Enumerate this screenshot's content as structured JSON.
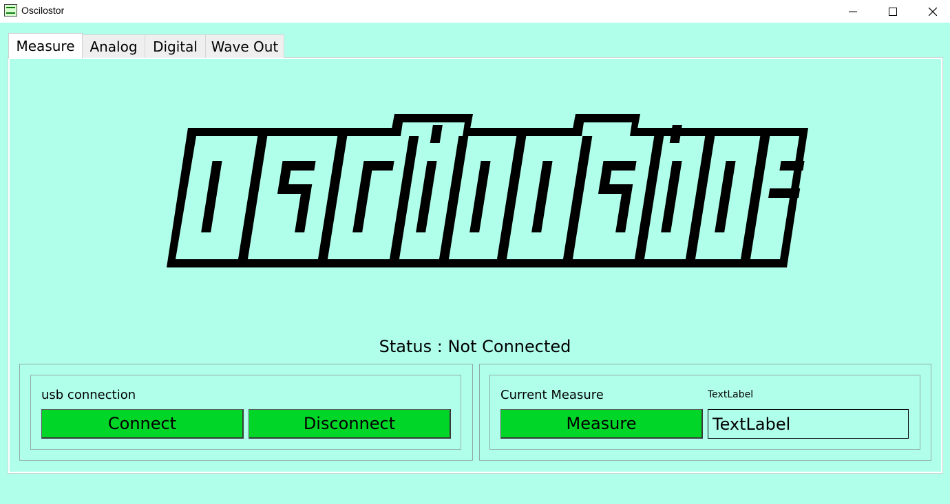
{
  "window": {
    "title": "Oscilostor",
    "app_icon": "oscilloscope-icon",
    "controls": [
      "minimize-icon",
      "maximize-icon",
      "close-icon"
    ]
  },
  "tabs": [
    {
      "label": "Measure",
      "active": true
    },
    {
      "label": "Analog",
      "active": false
    },
    {
      "label": "Digital",
      "active": false
    },
    {
      "label": "Wave Out",
      "active": false
    }
  ],
  "logo": {
    "text": "OSCILOSTOR"
  },
  "status": {
    "text": "Status : Not Connected"
  },
  "usb_group": {
    "label": "usb connection",
    "connect_label": "Connect",
    "disconnect_label": "Disconnect"
  },
  "measure_group": {
    "label": "Current Measure",
    "small_label": "TextLabel",
    "measure_label": "Measure",
    "value_label": "TextLabel"
  },
  "colors": {
    "background": "#b0ffea",
    "button_green": "#00d628",
    "title_bar": "#ffffff"
  }
}
